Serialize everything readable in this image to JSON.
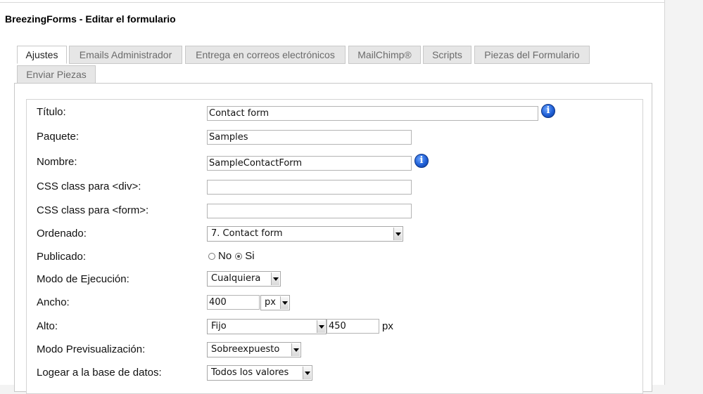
{
  "header": {
    "title": "BreezingForms - Editar el formulario"
  },
  "tabs": [
    {
      "label": "Ajustes",
      "active": true
    },
    {
      "label": "Emails Administrador",
      "active": false
    },
    {
      "label": "Entrega en correos electrónicos",
      "active": false
    },
    {
      "label": "MailChimp®",
      "active": false
    },
    {
      "label": "Scripts",
      "active": false
    },
    {
      "label": "Piezas del Formulario",
      "active": false
    },
    {
      "label": "Enviar Piezas",
      "active": false
    }
  ],
  "form": {
    "titulo": {
      "label": "Título:",
      "value": "Contact form"
    },
    "paquete": {
      "label": "Paquete:",
      "value": "Samples"
    },
    "nombre": {
      "label": "Nombre:",
      "value": "SampleContactForm"
    },
    "css_div": {
      "label": "CSS class para <div>:",
      "value": ""
    },
    "css_form": {
      "label": "CSS class para <form>:",
      "value": ""
    },
    "ordenado": {
      "label": "Ordenado:",
      "value": "7. Contact form"
    },
    "publicado": {
      "label": "Publicado:",
      "option_no": "No",
      "option_si": "Si",
      "selected": "Si"
    },
    "modo_ejecucion": {
      "label": "Modo de Ejecución:",
      "value": "Cualquiera"
    },
    "ancho": {
      "label": "Ancho:",
      "value": "400",
      "unit": "px"
    },
    "alto": {
      "label": "Alto:",
      "mode": "Fijo",
      "value": "450",
      "unit": "px"
    },
    "modo_previsualizacion": {
      "label": "Modo Previsualización:",
      "value": "Sobreexpuesto"
    },
    "logear": {
      "label": "Logear a la base de datos:",
      "value": "Todos los valores"
    }
  },
  "icons": {
    "info": "i"
  },
  "colors": {
    "info_blue": "#1f5fd6",
    "tab_bg": "#e6e6e6",
    "tab_text": "#6b6b6b"
  }
}
